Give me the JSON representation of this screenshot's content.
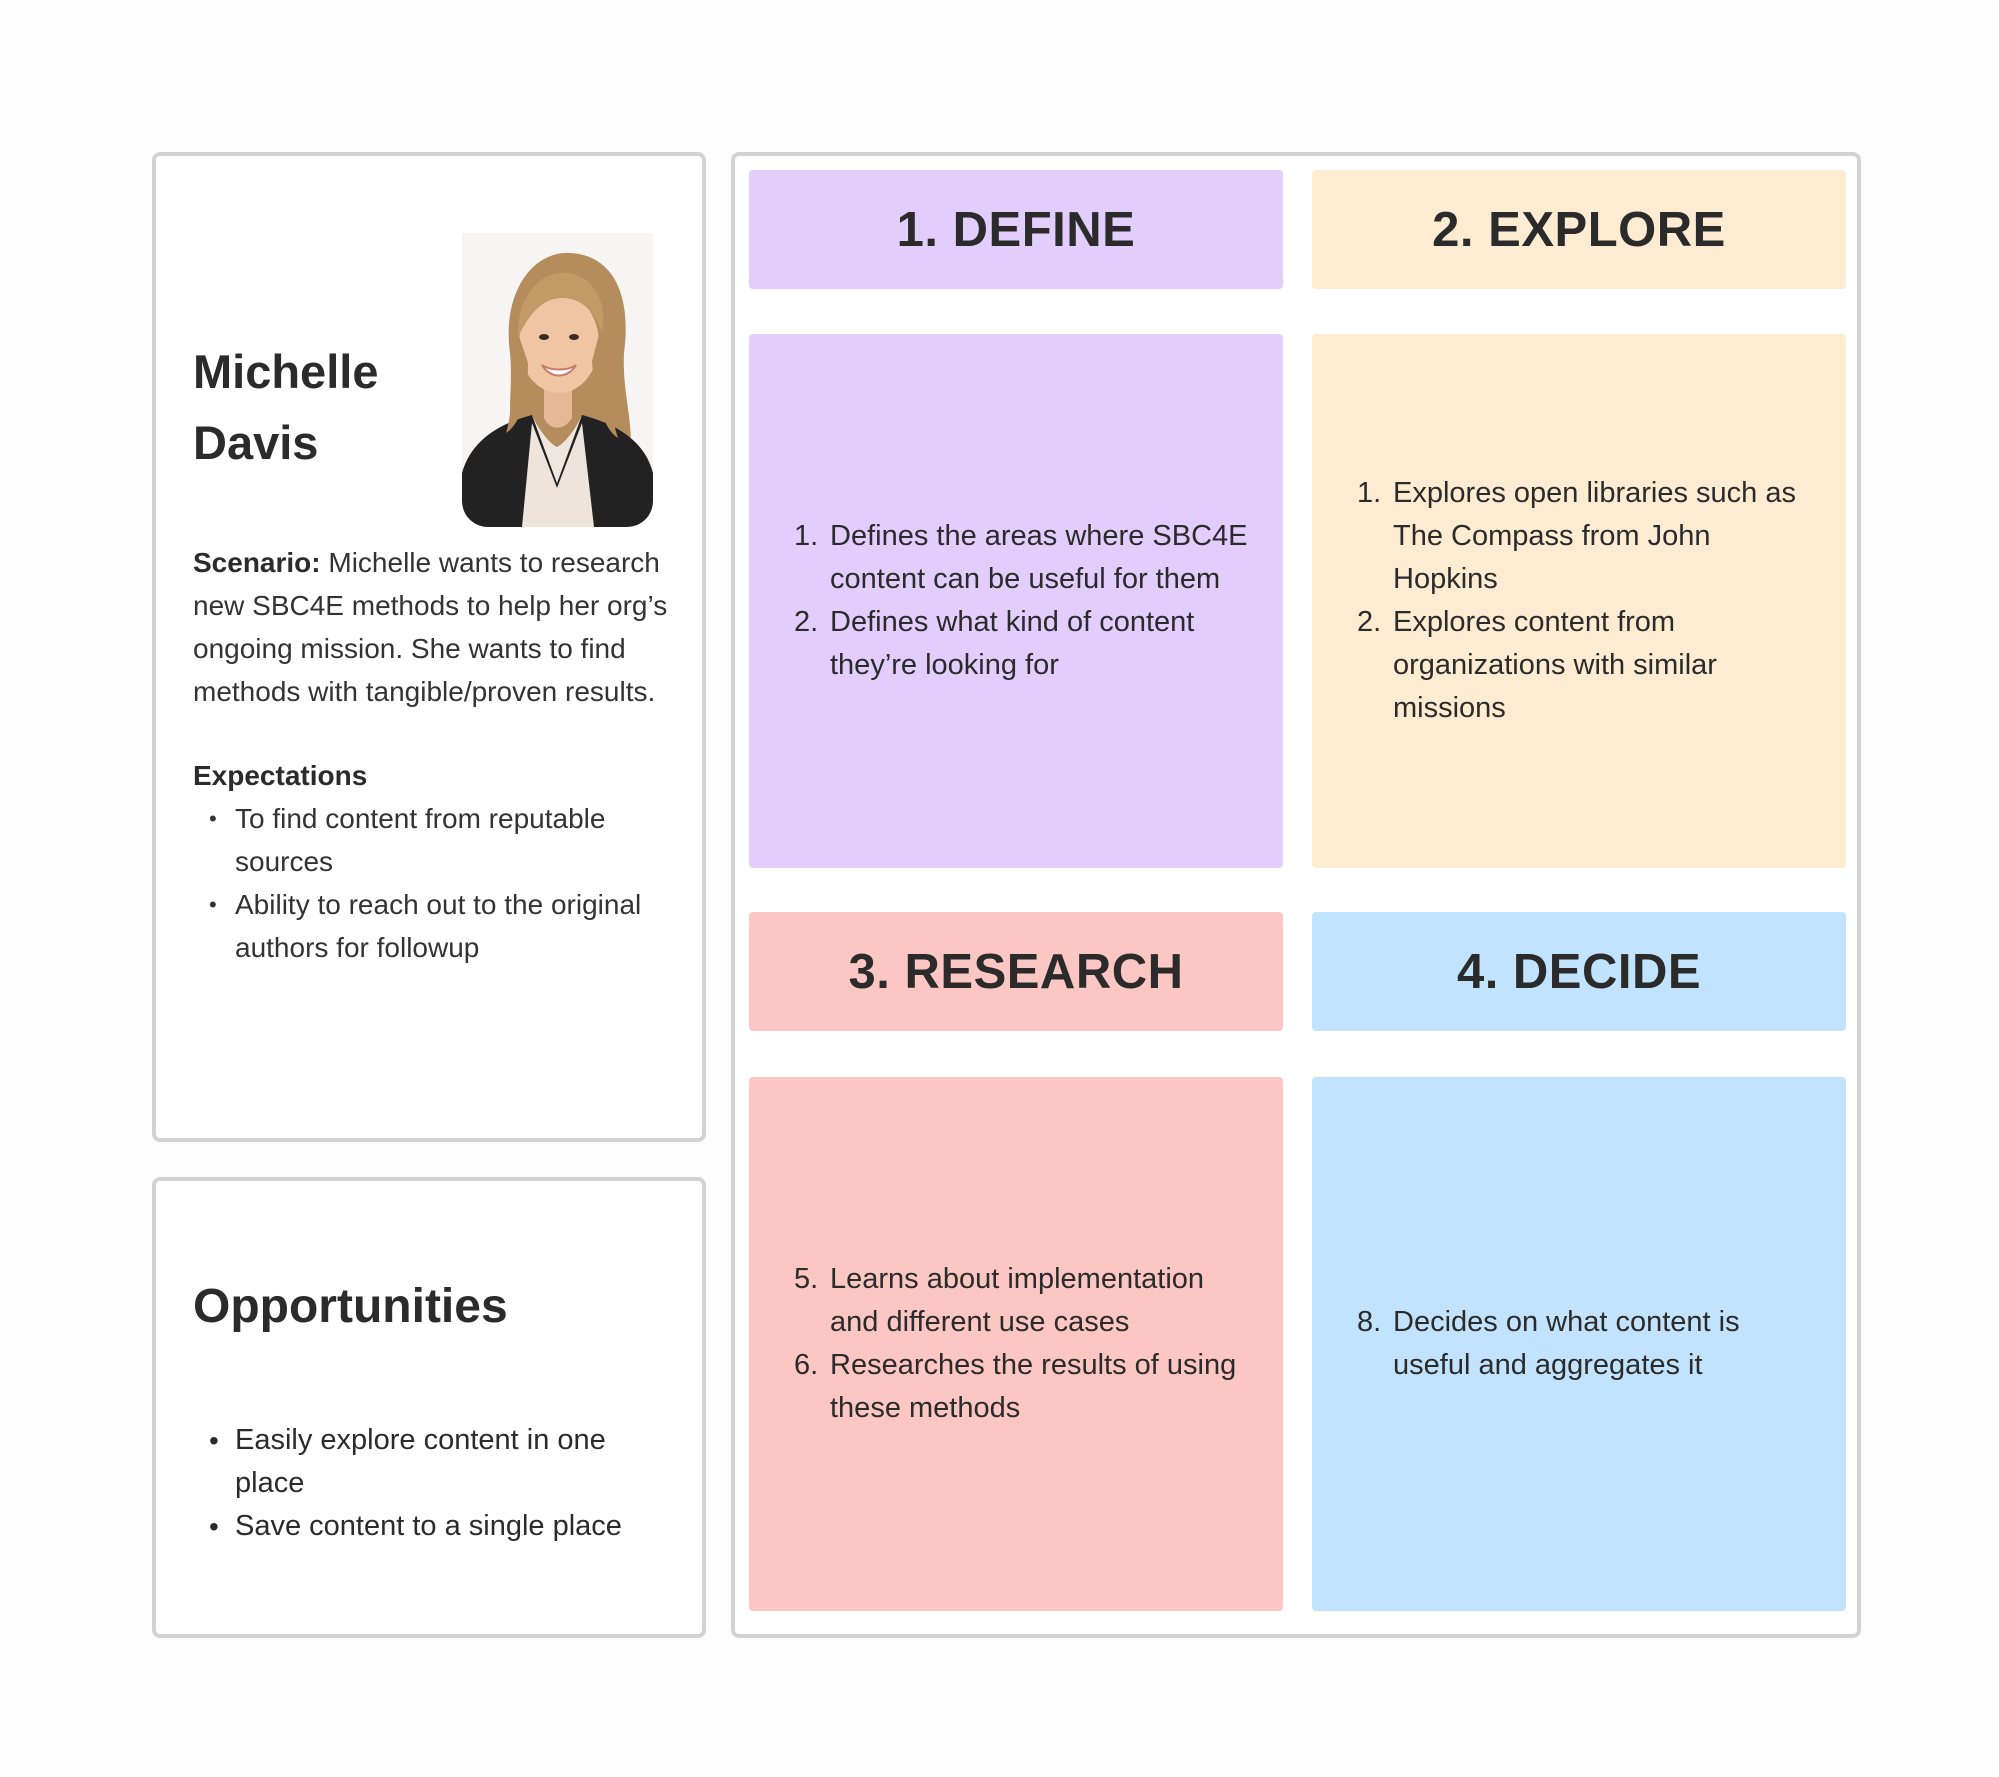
{
  "persona": {
    "first_name": "Michelle",
    "last_name": "Davis",
    "scenario_label": "Scenario:",
    "scenario_text": " Michelle wants to research new SBC4E methods to help her org’s ongoing mission. She wants to find methods with tangible/proven results.",
    "expectations_title": "Expectations",
    "expectations": [
      "To find content from reputable sources",
      "Ability to reach out to the original authors for followup"
    ]
  },
  "opportunities": {
    "title": "Opportunities",
    "items": [
      "Easily explore content in one place",
      "Save content to a single place"
    ]
  },
  "stages": [
    {
      "title": "1. DEFINE",
      "color": "#e2cdfc",
      "steps": [
        {
          "num": "1.",
          "text": "Defines the areas where SBC4E content can be useful for them"
        },
        {
          "num": "2.",
          "text": "Defines what kind of content they’re looking for"
        }
      ]
    },
    {
      "title": "2. EXPLORE",
      "color": "#fdebd2",
      "steps": [
        {
          "num": "1.",
          "text": "Explores open libraries such as The Compass from John Hopkins"
        },
        {
          "num": "2.",
          "text": "Explores content from organizations with similar missions"
        }
      ]
    },
    {
      "title": "3. RESEARCH",
      "color": "#fcc6c2",
      "steps": [
        {
          "num": "5.",
          "text": "Learns about implementation and different use cases"
        },
        {
          "num": "6.",
          "text": "Researches the results of using these methods"
        }
      ]
    },
    {
      "title": "4. DECIDE",
      "color": "#c2e3fd",
      "steps": [
        {
          "num": "8.",
          "text": "Decides on what content is useful and aggregates it"
        }
      ]
    }
  ]
}
